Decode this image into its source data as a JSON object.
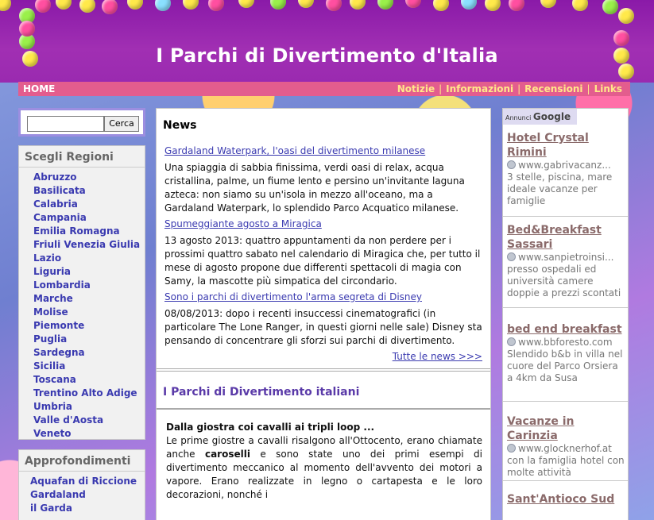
{
  "header": {
    "title": "I Parchi di Divertimento d'Italia"
  },
  "nav": {
    "home": "HOME",
    "links": [
      "Notizie",
      "Informazioni",
      "Recensioni",
      "Links"
    ],
    "separator": "|"
  },
  "search": {
    "value": "",
    "button": "Cerca"
  },
  "regions": {
    "title": "Scegli Regioni",
    "items": [
      "Abruzzo",
      "Basilicata",
      "Calabria",
      "Campania",
      "Emilia Romagna",
      "Friuli Venezia Giulia",
      "Lazio",
      "Liguria",
      "Lombardia",
      "Marche",
      "Molise",
      "Piemonte",
      "Puglia",
      "Sardegna",
      "Sicilia",
      "Toscana",
      "Trentino Alto Adige",
      "Umbria",
      "Valle d'Aosta",
      "Veneto"
    ]
  },
  "approfondimenti": {
    "title": "Approfondimenti",
    "items": [
      "Aquafan di Riccione",
      "Gardaland",
      "il Garda"
    ]
  },
  "news": {
    "title": "News",
    "items": [
      {
        "title": "Gardaland Waterpark, l'oasi del divertimento milanese",
        "text": "Una spiaggia di sabbia finissima, verdi oasi di relax, acqua cristallina, palme, un fiume lento e persino un'invitante laguna azteca: non siamo su un'isola in mezzo all'oceano, ma a Gardaland Waterpark, lo splendido Parco Acquatico milanese."
      },
      {
        "title": "Spumeggiante agosto a Miragica",
        "text": "13 agosto 2013: quattro appuntamenti da non perdere per i prossimi quattro sabato nel calendario di Miragica che, per tutto il mese di agosto propone due differenti spettacoli di magia con Samy, la mascotte più simpatica del circondario."
      },
      {
        "title": "Sono i parchi di divertimento l'arma segreta di Disney",
        "text": "08/08/2013: dopo i recenti insuccessi cinematografici (in particolare The Lone Ranger, in questi giorni nelle sale) Disney sta pensando di concentrare gli sforzi sui parchi di divertimento."
      }
    ],
    "all_news": "Tutte le news >>>"
  },
  "section": {
    "title": "I Parchi di Divertimento italiani",
    "lead": "Dalla giostra coi cavalli ai tripli loop ...",
    "text_before": "Le prime giostre a cavalli risalgono all'Ottocento, erano chiamate anche ",
    "text_bold": "caroselli",
    "text_after": " e sono state uno dei primi esempi di divertimento meccanico al momento dell'avvento dei motori a vapore. Erano realizzate in legno o cartapesta e le loro decorazioni, nonché i"
  },
  "ads": {
    "label": "Annunci",
    "logo": "Google",
    "items": [
      {
        "title": "Hotel Crystal Rimini",
        "url": "www.gabrivacanz...",
        "text": "3 stelle, piscina, mare ideale vacanze per famiglie"
      },
      {
        "title": "Bed&Breakfast Sassari",
        "url": "www.sanpietroinsi...",
        "text": "presso ospedali ed università camere doppie a prezzi scontati"
      },
      {
        "title": "bed end breakfast",
        "url": "www.bbforesto.com",
        "text": "Slendido b&b in villa nel cuore del Parco Orsiera a 4km da Susa"
      },
      {
        "title": "Vacanze in Carinzia",
        "url": "www.glocknerhof.at",
        "text": "con la famiglia hotel con molte attività"
      },
      {
        "title": "Sant'Antioco Sud",
        "url": "",
        "text": ""
      }
    ]
  },
  "colors": {
    "header_bg": "#9a2ab0",
    "nav_bg": "#e35d8e",
    "nav_link": "#ffe889",
    "link": "#3a3ab0",
    "ad_title": "#8a6a6a"
  }
}
